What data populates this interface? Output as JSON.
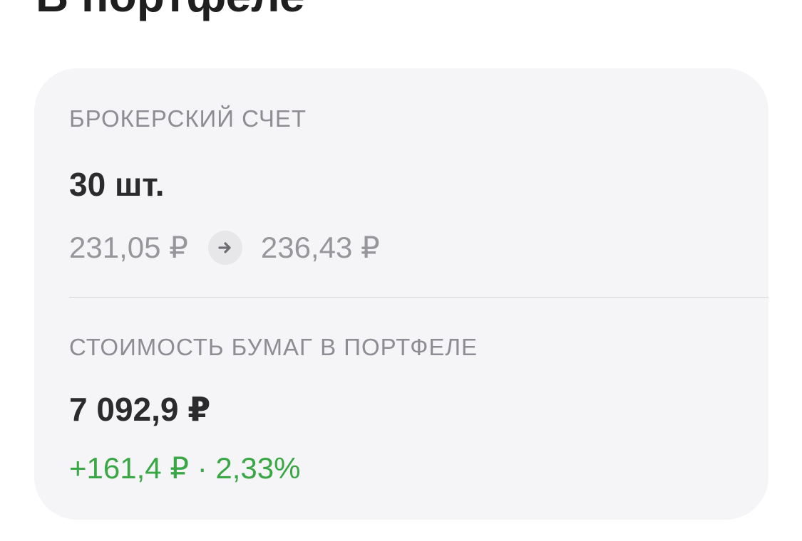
{
  "header": {
    "title": "В портфеле"
  },
  "card": {
    "account_label": "БРОКЕРСКИЙ СЧЕТ",
    "quantity": "30 шт.",
    "price_from": "231,05 ₽",
    "arrow_icon": "arrow-right-icon",
    "price_to": "236,43 ₽",
    "value_label": "СТОИМОСТЬ БУМАГ В ПОРТФЕЛЕ",
    "total_value": "7 092,9 ₽",
    "change": "+161,4 ₽ · 2,33%"
  },
  "colors": {
    "card_bg": "#f5f5f7",
    "label": "#8d8d93",
    "value": "#2b2b2d",
    "muted_price": "#96969b",
    "positive": "#3aa745"
  }
}
